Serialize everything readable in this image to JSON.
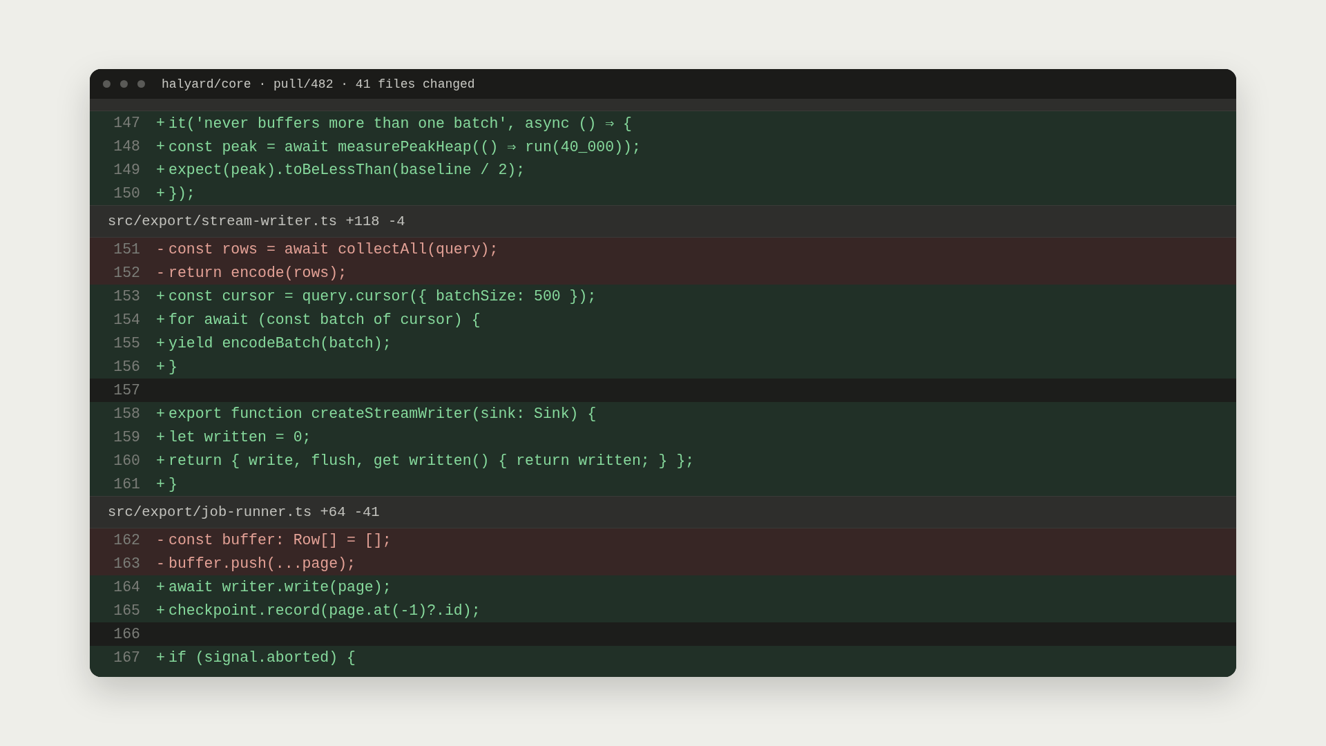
{
  "window": {
    "title": "halyard/core · pull/482 · 41 files changed"
  },
  "sections": [
    {
      "lines": [
        {
          "number": "147",
          "kind": "add",
          "sign": "+",
          "text": "it('never buffers more than one batch', async () ⇒ {"
        },
        {
          "number": "148",
          "kind": "add",
          "sign": "+",
          "text": "const peak = await measurePeakHeap(() ⇒ run(40_000));"
        },
        {
          "number": "149",
          "kind": "add",
          "sign": "+",
          "text": "expect(peak).toBeLessThan(baseline / 2);"
        },
        {
          "number": "150",
          "kind": "add",
          "sign": "+",
          "text": "});"
        }
      ]
    },
    {
      "file": "src/export/stream-writer.ts +118 -4",
      "lines": [
        {
          "number": "151",
          "kind": "del",
          "sign": "-",
          "text": "const rows = await collectAll(query);"
        },
        {
          "number": "152",
          "kind": "del",
          "sign": "-",
          "text": "return encode(rows);"
        },
        {
          "number": "153",
          "kind": "add",
          "sign": "+",
          "text": "const cursor = query.cursor({ batchSize: 500 });"
        },
        {
          "number": "154",
          "kind": "add",
          "sign": "+",
          "text": "for await (const batch of cursor) {"
        },
        {
          "number": "155",
          "kind": "add",
          "sign": "+",
          "text": "yield encodeBatch(batch);"
        },
        {
          "number": "156",
          "kind": "add",
          "sign": "+",
          "text": "}"
        },
        {
          "number": "157",
          "kind": "context"
        },
        {
          "number": "158",
          "kind": "add",
          "sign": "+",
          "text": "export function createStreamWriter(sink: Sink) {"
        },
        {
          "number": "159",
          "kind": "add",
          "sign": "+",
          "text": "let written = 0;"
        },
        {
          "number": "160",
          "kind": "add",
          "sign": "+",
          "text": "return { write, flush, get written() { return written; } };"
        },
        {
          "number": "161",
          "kind": "add",
          "sign": "+",
          "text": "}"
        }
      ]
    },
    {
      "file": "src/export/job-runner.ts +64 -41",
      "lines": [
        {
          "number": "162",
          "kind": "del",
          "sign": "-",
          "text": "const buffer: Row[] = [];"
        },
        {
          "number": "163",
          "kind": "del",
          "sign": "-",
          "text": "buffer.push(...page);"
        },
        {
          "number": "164",
          "kind": "add",
          "sign": "+",
          "text": "await writer.write(page);"
        },
        {
          "number": "165",
          "kind": "add",
          "sign": "+",
          "text": "checkpoint.record(page.at(-1)?.id);"
        },
        {
          "number": "166",
          "kind": "context"
        },
        {
          "number": "167",
          "kind": "add",
          "sign": "+",
          "text": "if (signal.aborted) {"
        }
      ]
    }
  ]
}
